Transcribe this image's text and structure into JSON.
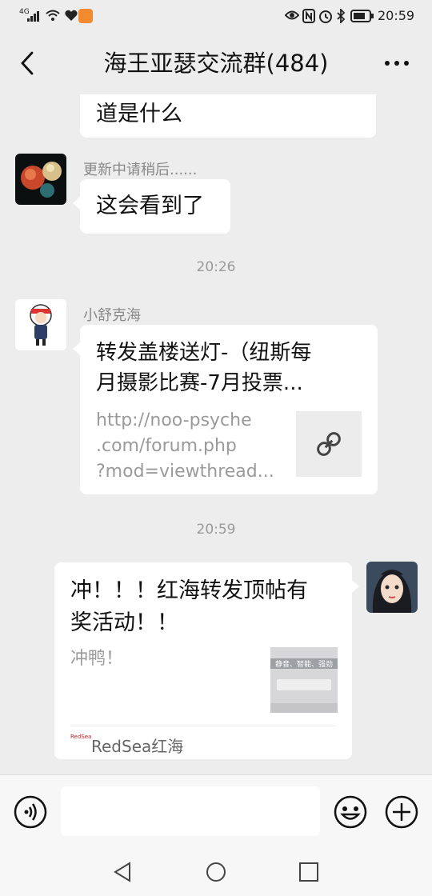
{
  "status_bar": {
    "network": "4G",
    "time": "20:59"
  },
  "header": {
    "title": "海王亚瑟交流群(484)"
  },
  "messages": {
    "partial_top": {
      "text": "道是什么"
    },
    "msg1": {
      "sender": "更新中请稍后......",
      "text": "这会看到了"
    },
    "time1": "20:26",
    "msg2": {
      "sender": "小舒克海",
      "title": "转发盖楼送灯-（纽斯每月摄影比赛-7月投票...",
      "title_line1": "转发盖楼送灯-（纽斯每",
      "title_line2": "月摄影比赛-7月投票...",
      "url_line1": "http://noo-psyche",
      "url_line2": ".com/forum.php",
      "url_line3": "?mod=viewthread..."
    },
    "time2": "20:59",
    "msg3": {
      "title_line1": "冲！！！红海转发顶帖有",
      "title_line2": "奖活动！！",
      "desc": "冲鸭！",
      "thumb_caption": "静音、智能、强劲",
      "source_logo": "RedSea",
      "source": "RedSea红海"
    }
  },
  "input": {
    "placeholder": ""
  },
  "icons": {
    "back": "back-arrow-icon",
    "more": "more-dots-icon",
    "voice": "voice-icon",
    "emoji": "emoji-icon",
    "plus": "plus-icon",
    "link": "link-icon"
  },
  "colors": {
    "background": "#ededed",
    "bubble": "#ffffff",
    "meta": "#888888"
  }
}
